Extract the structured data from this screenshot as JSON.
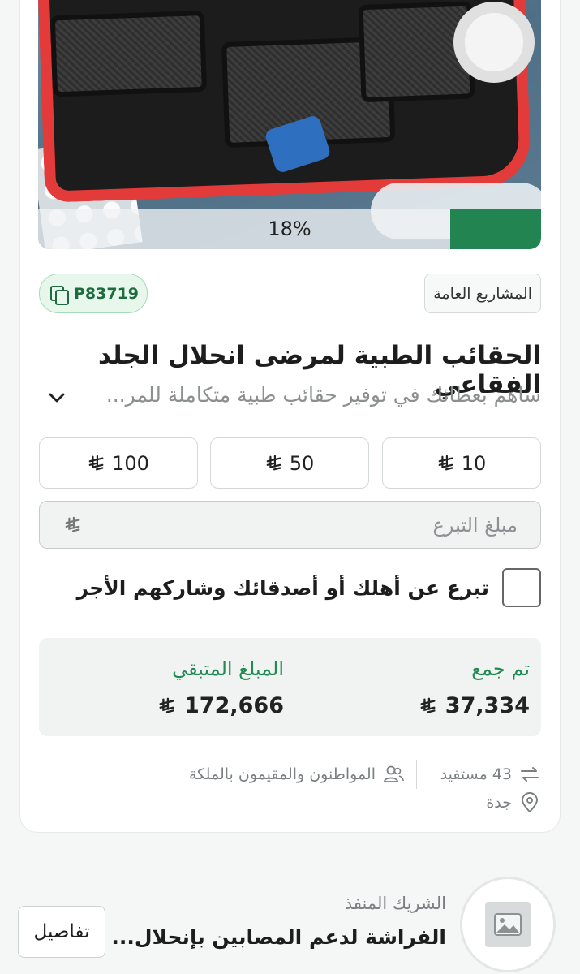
{
  "project": {
    "progress_percent": 18,
    "progress_label": "18%",
    "category": "المشاريع العامة",
    "code": "P83719",
    "title": "الحقائب الطبية لمرضى انحلال الجلد الفقاعي",
    "subtitle": "ساهم بعطائك في توفير حقائب طبية متكاملة للمر..."
  },
  "amounts": [
    {
      "value": "10"
    },
    {
      "value": "50"
    },
    {
      "value": "100"
    }
  ],
  "donate_input": {
    "placeholder": "مبلغ التبرع",
    "value": ""
  },
  "gift": {
    "label": "تبرع عن أهلك أو أصدقائك وشاركهم الأجر"
  },
  "stats": {
    "collected_label": "تم جمع",
    "collected_value": "37,334",
    "remaining_label": "المبلغ المتبقي",
    "remaining_value": "172,666"
  },
  "meta": {
    "beneficiaries": "43 مستفيد",
    "audience": "المواطنون والمقيمون بالملكة",
    "location": "جدة"
  },
  "partner": {
    "caption": "الشريك المنفذ",
    "name": "الفراشة لدعم المصابين بإنحلال...",
    "details_button": "تفاصيل"
  },
  "colors": {
    "accent": "#228551",
    "code_badge_bg": "#e8f7ec"
  }
}
